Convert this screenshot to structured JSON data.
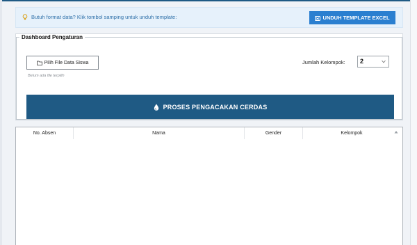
{
  "info_bar": {
    "hint": "Butuh format data? Klik tombol samping untuk unduh template:",
    "template_button": "UNDUH TEMPLATE EXCEL"
  },
  "settings": {
    "group_title": "Dashboard Pengaturan",
    "file_button": "Pilih File Data Siswa",
    "file_status": "Belum ada file terpilih",
    "kelompok_label": "Jumlah Kelompok:",
    "kelompok_value": "2",
    "process_button": "PROSES PENGACAKAN CERDAS"
  },
  "table": {
    "columns": [
      "No. Absen",
      "Nama",
      "Gender",
      "Kelompok"
    ],
    "rows": []
  },
  "colors": {
    "accent": "#1f5a84",
    "template_button": "#2a7fd0",
    "info_bg": "#e6f1fb"
  },
  "icons": [
    "lightbulb-icon",
    "excel-icon",
    "folder-icon",
    "chevron-down-icon",
    "drop-icon",
    "scroll-up-icon"
  ]
}
